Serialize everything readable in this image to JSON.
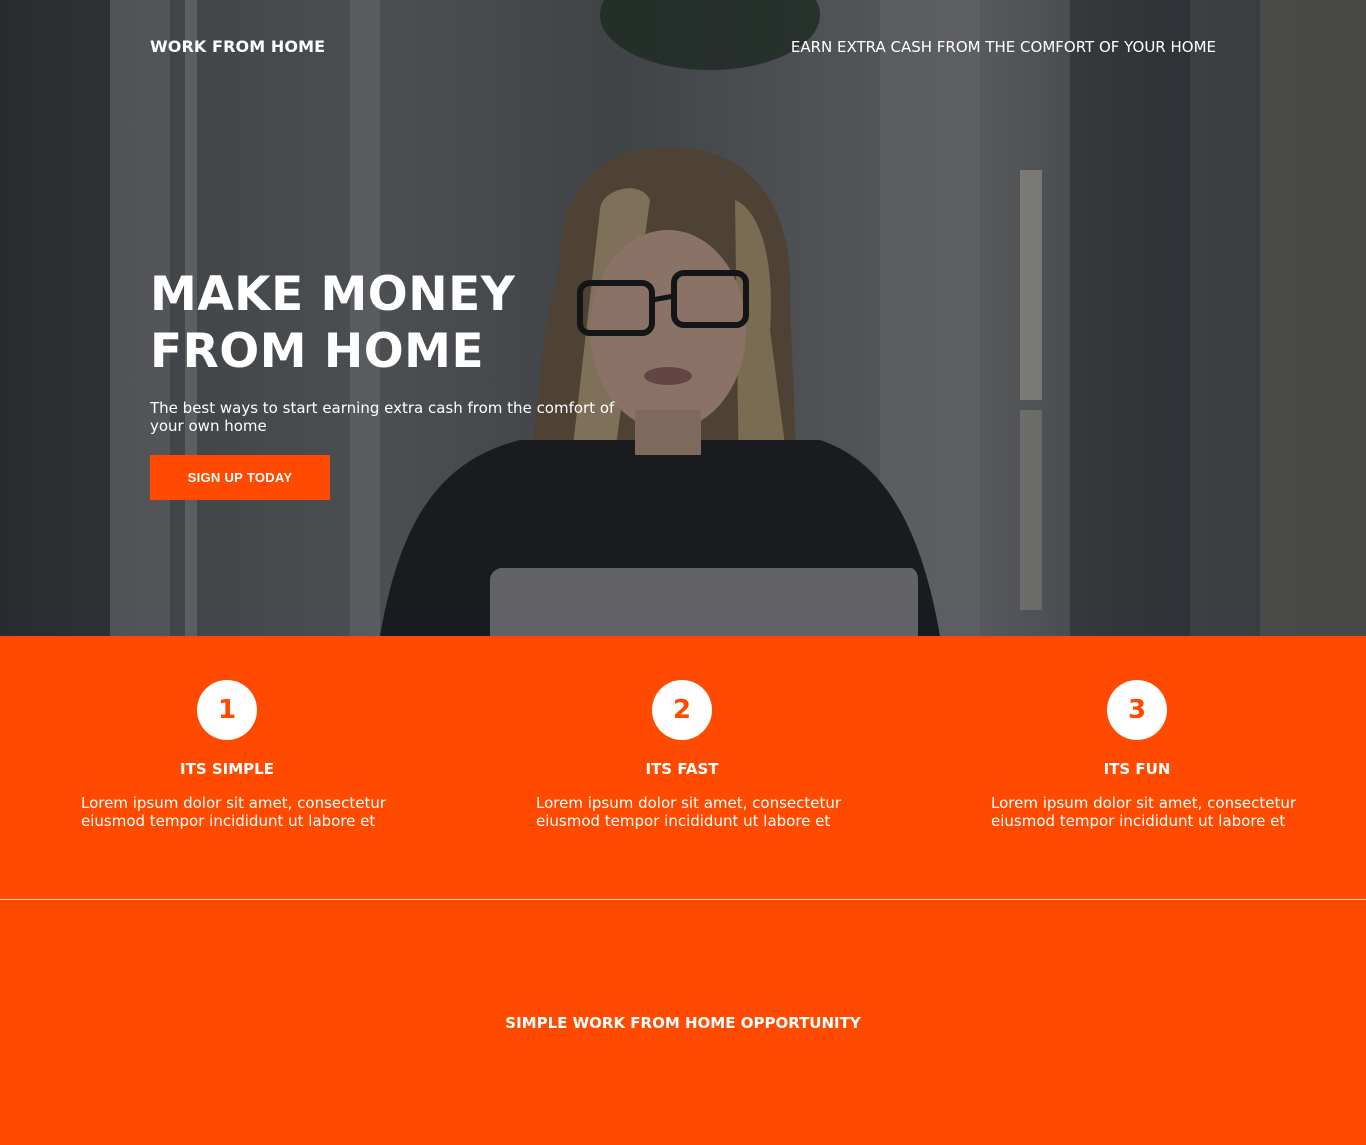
{
  "header": {
    "brand": "WORK FROM HOME",
    "tagline": "EARN EXTRA CASH FROM THE COMFORT OF YOUR HOME"
  },
  "hero": {
    "title_line1": "MAKE MONEY",
    "title_line2": "FROM HOME",
    "subtitle": "The best ways to start earning extra cash from the comfort of your own home",
    "cta_label": "SIGN UP TODAY"
  },
  "features": [
    {
      "number": "1",
      "title": "ITS SIMPLE",
      "text": "Lorem ipsum dolor sit amet, consectetur eiusmod tempor incididunt ut labore et"
    },
    {
      "number": "2",
      "title": "ITS FAST",
      "text": "Lorem ipsum dolor sit amet, consectetur eiusmod tempor incididunt ut labore et"
    },
    {
      "number": "3",
      "title": "ITS FUN",
      "text": "Lorem ipsum dolor sit amet, consectetur eiusmod tempor incididunt ut labore et"
    }
  ],
  "opportunity": {
    "heading": "SIMPLE WORK FROM HOME OPPORTUNITY"
  },
  "colors": {
    "accent": "#ff4a00",
    "text": "#ffffff"
  }
}
